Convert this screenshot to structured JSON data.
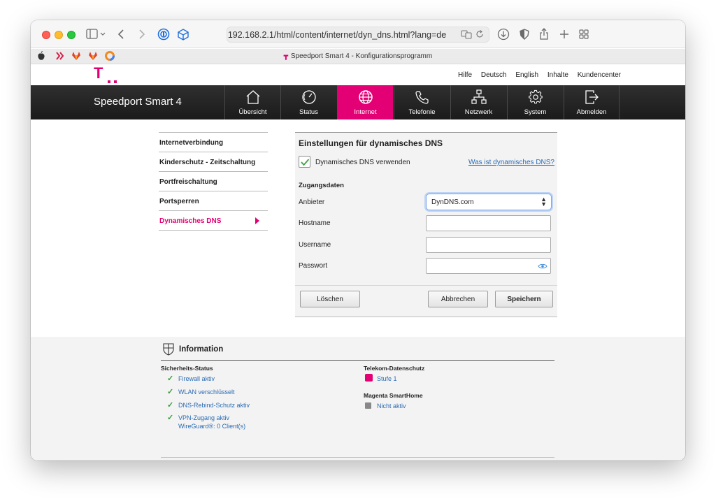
{
  "browser": {
    "url": "192.168.2.1/html/content/internet/dyn_dns.html?lang=de",
    "tab_title": "Speedport Smart 4 - Konfigurationsprogramm"
  },
  "header": {
    "logo_letter": "T",
    "links": [
      "Hilfe",
      "Deutsch",
      "English",
      "Inhalte",
      "Kundencenter"
    ]
  },
  "nav": {
    "brand": "Speedport Smart 4",
    "items": [
      {
        "label": "Übersicht",
        "icon": "home-icon"
      },
      {
        "label": "Status",
        "icon": "gauge-icon"
      },
      {
        "label": "Internet",
        "icon": "globe-icon"
      },
      {
        "label": "Telefonie",
        "icon": "phone-icon"
      },
      {
        "label": "Netzwerk",
        "icon": "network-icon"
      },
      {
        "label": "System",
        "icon": "gear-icon"
      },
      {
        "label": "Abmelden",
        "icon": "logout-icon"
      }
    ],
    "active_color": "#e20074"
  },
  "sidebar": {
    "items": [
      {
        "label": "Internetverbindung"
      },
      {
        "label": "Kinderschutz - Zeitschaltung"
      },
      {
        "label": "Portfreischaltung"
      },
      {
        "label": "Portsperren"
      },
      {
        "label": "Dynamisches DNS"
      }
    ]
  },
  "form": {
    "title": "Einstellungen für dynamisches DNS",
    "checkbox_label": "Dynamisches DNS verwenden",
    "help_link": "Was ist dynamisches DNS?",
    "section": "Zugangsdaten",
    "provider_label": "Anbieter",
    "provider_value": "DynDNS.com",
    "hostname_label": "Hostname",
    "username_label": "Username",
    "password_label": "Passwort",
    "hostname_value": "",
    "username_value": "",
    "password_value": "",
    "delete_button": "Löschen",
    "cancel_button": "Abbrechen",
    "save_button": "Speichern"
  },
  "info": {
    "title": "Information",
    "security_heading": "Sicherheits-Status",
    "security_items": [
      "Firewall aktiv",
      "WLAN verschlüsselt",
      "DNS-Rebind-Schutz aktiv",
      "VPN-Zugang aktiv",
      "WireGuard®: 0 Client(s)"
    ],
    "privacy_heading": "Telekom-Datenschutz",
    "privacy_value": "Stufe 1",
    "smarthome_heading": "Magenta SmartHome",
    "smarthome_value": "Nicht aktiv"
  }
}
